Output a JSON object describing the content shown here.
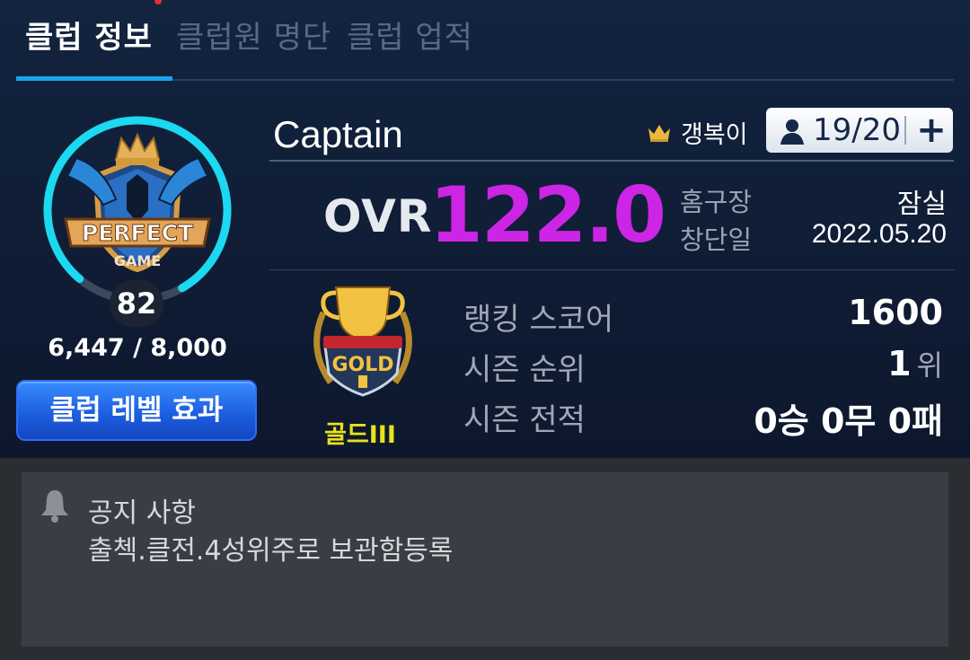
{
  "tabs": [
    {
      "label": "클럽 정보"
    },
    {
      "label": "클럽원 명단"
    },
    {
      "label": "클럽 업적"
    }
  ],
  "club": {
    "emblem_text_top": "PERFECT",
    "emblem_text_bottom": "GAME",
    "level": "82",
    "exp": "6,447 / 8,000",
    "exp_fraction": 0.806,
    "level_effect_label": "클럽 레벨 효과",
    "name": "Captain",
    "leader": "갱복이",
    "members": "19/20",
    "add_icon": "plus-icon",
    "ovr_label": "OVR",
    "ovr_value": "122.0",
    "home_label": "홈구장",
    "home_value": "잠실",
    "founded_label": "창단일",
    "founded_value": "2022.05.20"
  },
  "tier": {
    "badge_text": "GOLD",
    "name": "골드III"
  },
  "stats": {
    "ranking_score_label": "랭킹 스코어",
    "ranking_score_value": "1600",
    "season_rank_label": "시즌 순위",
    "season_rank_value": "1",
    "season_rank_unit": "위",
    "season_record_label": "시즌 전적",
    "season_record_value": "0승 0무 0패"
  },
  "notice": {
    "title": "공지 사항",
    "body": "출첵.클전.4성위주로 보관함등록"
  },
  "colors": {
    "background": "#0f1d33",
    "accent_blue": "#1aa3f0",
    "ovr_purple": "#cc25e6",
    "tier_yellow": "#e8e11c",
    "exp_ring": "#1ad9f0"
  }
}
